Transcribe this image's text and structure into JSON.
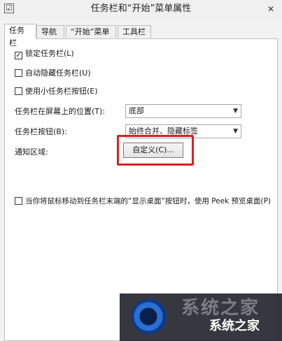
{
  "window": {
    "title": "任务栏和“开始”菜单属性",
    "close_glyph": "✕",
    "app_icon_glyph": "☑"
  },
  "tabs": [
    {
      "label": "任务栏",
      "active": true
    },
    {
      "label": "导航",
      "active": false
    },
    {
      "label": "“开始”菜单",
      "active": false
    },
    {
      "label": "工具栏",
      "active": false
    }
  ],
  "options": {
    "lock_taskbar": {
      "label": "锁定任务栏(L)",
      "checked": true
    },
    "auto_hide": {
      "label": "自动隐藏任务栏(U)",
      "checked": false
    },
    "small_buttons": {
      "label": "使用小任务栏按钮(E)",
      "checked": false
    },
    "peek": {
      "label": "当你将鼠标移动到任务栏末端的“显示桌面”按钮时，使用 Peek 预览桌面(P)",
      "checked": false
    }
  },
  "location": {
    "label": "任务栏在屏幕上的位置(T):",
    "value": "底部"
  },
  "buttons_setting": {
    "label": "任务栏按钮(B):",
    "value": "始终合并、隐藏标签"
  },
  "notification_area": {
    "label": "通知区域:",
    "customize_label": "自定义(C)..."
  },
  "watermark": {
    "text": "系统之家",
    "faint_text": "系统之家"
  },
  "colors": {
    "highlight": "#d92020",
    "accent": "#2a6fd4"
  }
}
